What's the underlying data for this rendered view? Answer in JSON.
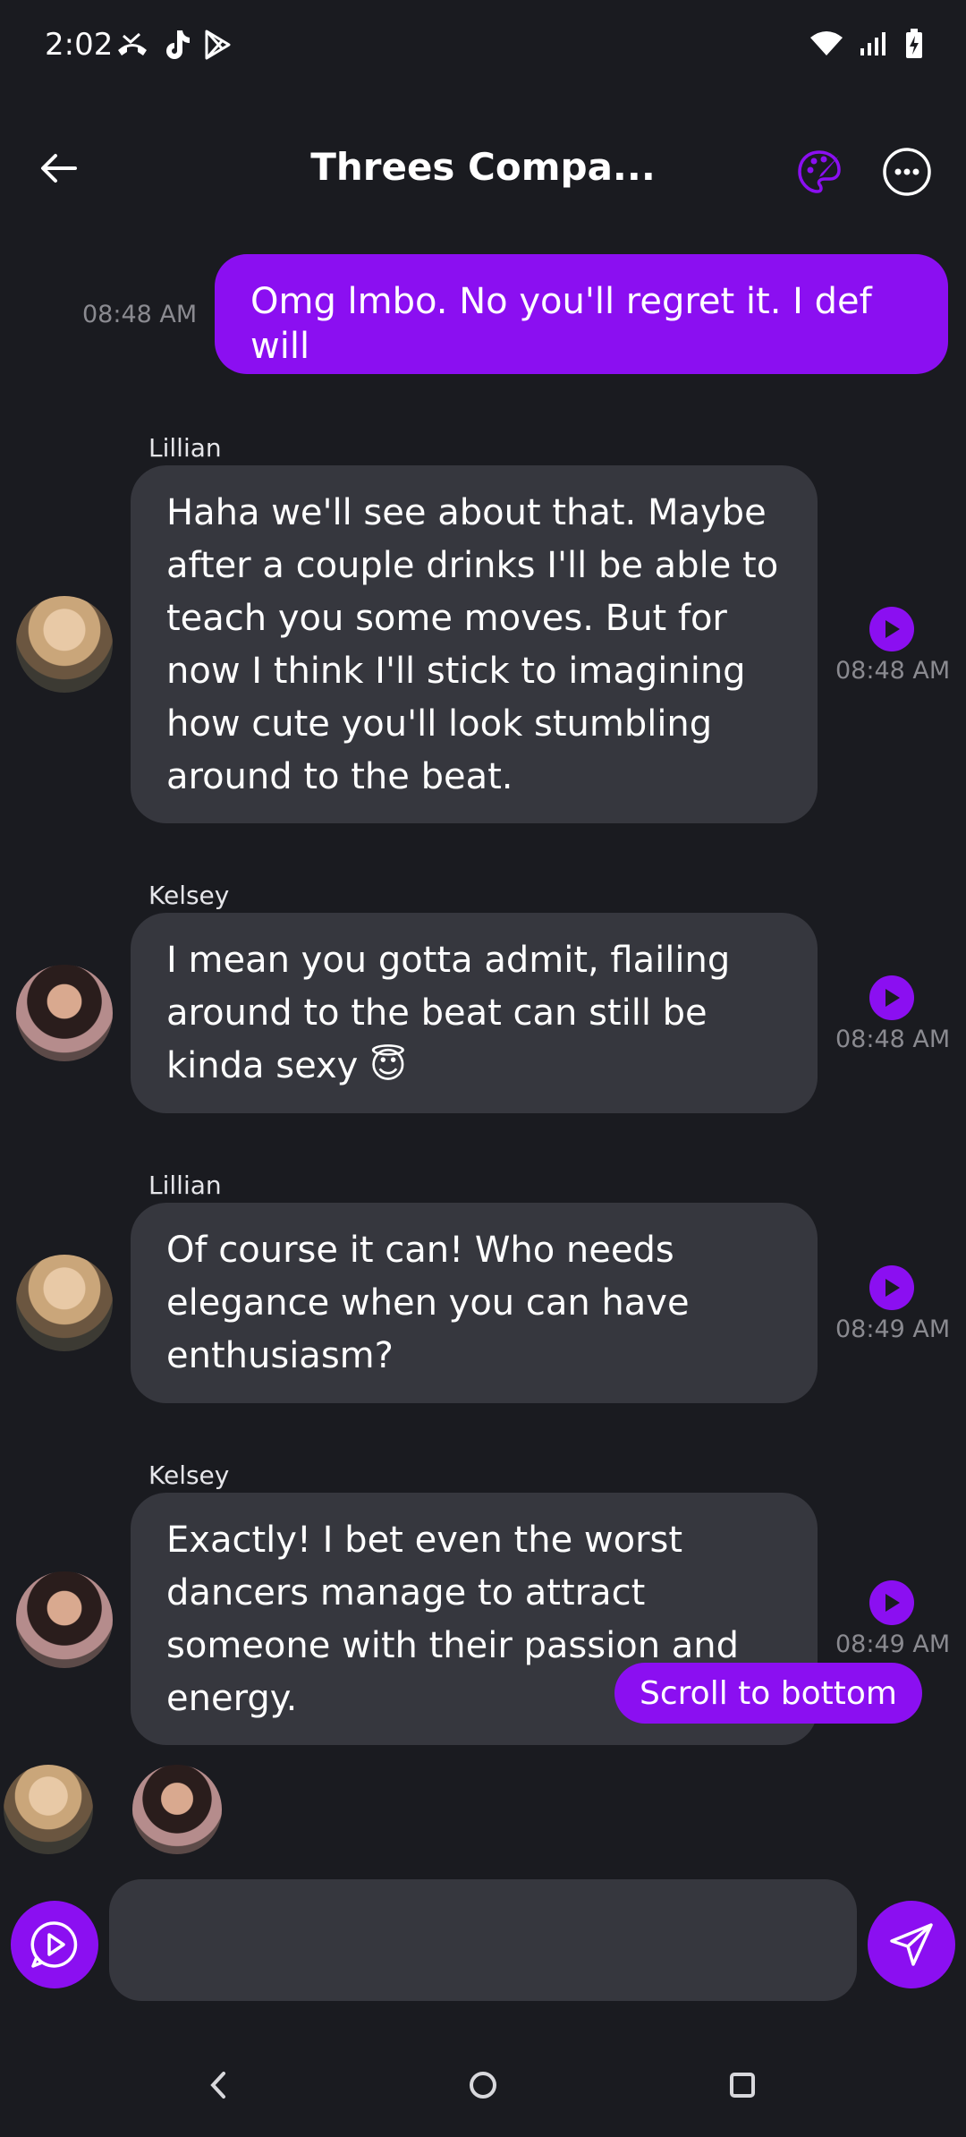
{
  "status_bar": {
    "time": "2:02",
    "left_icons": [
      "missed-call-icon",
      "tiktok-icon",
      "play-store-icon"
    ],
    "right_icons": [
      "wifi-icon",
      "signal-icon",
      "battery-charging-icon"
    ]
  },
  "header": {
    "title": "Threes Compa...",
    "back_icon": "arrow-left-icon",
    "palette_icon": "palette-icon",
    "more_icon": "more-horizontal-icon"
  },
  "messages": [
    {
      "type": "user",
      "text": "Omg lmbo. No you'll regret it. I def will",
      "time": "08:48 AM"
    },
    {
      "type": "bot",
      "sender": "Lillian",
      "text": "Haha we'll see about that. Maybe after a couple drinks I'll be able to teach you some moves. But for now I think I'll stick to imagining how cute you'll look stumbling around to the beat.",
      "time": "08:48 AM"
    },
    {
      "type": "bot",
      "sender": "Kelsey",
      "text": "I mean you gotta admit, flailing around to the beat can still be kinda sexy 😇",
      "time": "08:48 AM"
    },
    {
      "type": "bot",
      "sender": "Lillian",
      "text": "Of course it can! Who needs elegance when you can have enthusiasm?",
      "time": "08:49 AM"
    },
    {
      "type": "bot",
      "sender": "Kelsey",
      "text": "Exactly! I bet even the worst dancers manage to attract someone with their passion and energy.",
      "time": "08:49 AM"
    }
  ],
  "scroll_to_bottom": "Scroll to bottom",
  "composer": {
    "value": "",
    "placeholder": ""
  },
  "colors": {
    "background": "#1a1b20",
    "accent": "#8b0ff1",
    "bubble": "#36373e",
    "muted_text": "#8a8a90"
  }
}
